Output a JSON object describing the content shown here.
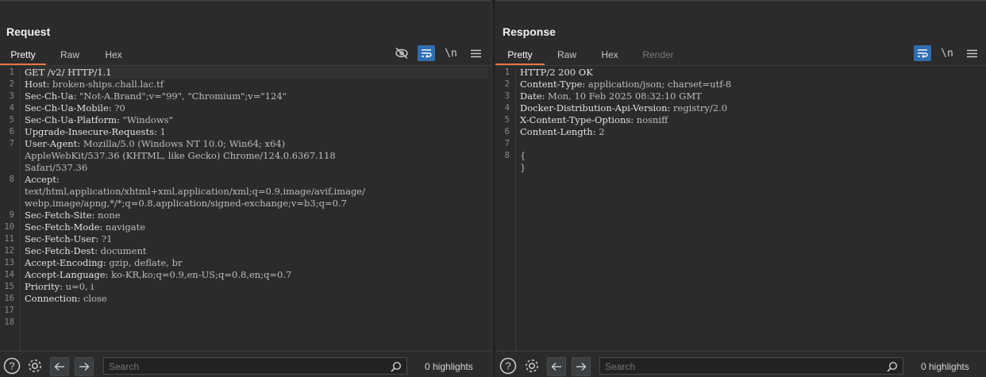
{
  "layout_buttons": [
    "side-by-side",
    "stacked",
    "single"
  ],
  "request": {
    "title": "Request",
    "tabs": [
      "Pretty",
      "Raw",
      "Hex"
    ],
    "active_tab": "Pretty",
    "newline_label": "\\n",
    "lines": [
      {
        "n": "1",
        "k": "GET /v2/ HTTP/1.1",
        "v": ""
      },
      {
        "n": "2",
        "k": "Host:",
        "v": " broken-ships.chall.lac.tf"
      },
      {
        "n": "3",
        "k": "Sec-Ch-Ua:",
        "v": " \"Not-A.Brand\";v=\"99\", \"Chromium\";v=\"124\""
      },
      {
        "n": "4",
        "k": "Sec-Ch-Ua-Mobile:",
        "v": " ?0"
      },
      {
        "n": "5",
        "k": "Sec-Ch-Ua-Platform:",
        "v": " \"Windows\""
      },
      {
        "n": "6",
        "k": "Upgrade-Insecure-Requests:",
        "v": " 1"
      },
      {
        "n": "7",
        "k": "User-Agent:",
        "v": " Mozilla/5.0 (Windows NT 10.0; Win64; x64)\nAppleWebKit/537.36 (KHTML, like Gecko) Chrome/124.0.6367.118\nSafari/537.36"
      },
      {
        "n": "8",
        "k": "Accept:",
        "v": "\ntext/html,application/xhtml+xml,application/xml;q=0.9,image/avif,image/\nwebp,image/apng,*/*;q=0.8,application/signed-exchange;v=b3;q=0.7"
      },
      {
        "n": "9",
        "k": "Sec-Fetch-Site:",
        "v": " none"
      },
      {
        "n": "10",
        "k": "Sec-Fetch-Mode:",
        "v": " navigate"
      },
      {
        "n": "11",
        "k": "Sec-Fetch-User:",
        "v": " ?1"
      },
      {
        "n": "12",
        "k": "Sec-Fetch-Dest:",
        "v": " document"
      },
      {
        "n": "13",
        "k": "Accept-Encoding:",
        "v": " gzip, deflate, br"
      },
      {
        "n": "14",
        "k": "Accept-Language:",
        "v": " ko-KR,ko;q=0.9,en-US;q=0.8,en;q=0.7"
      },
      {
        "n": "15",
        "k": "Priority:",
        "v": " u=0, i"
      },
      {
        "n": "16",
        "k": "Connection:",
        "v": " close"
      },
      {
        "n": "17",
        "k": "",
        "v": ""
      },
      {
        "n": "18",
        "k": "",
        "v": ""
      }
    ],
    "search_placeholder": "Search",
    "highlights": "0 highlights"
  },
  "response": {
    "title": "Response",
    "tabs": [
      "Pretty",
      "Raw",
      "Hex",
      "Render"
    ],
    "active_tab": "Pretty",
    "newline_label": "\\n",
    "lines": [
      {
        "n": "1",
        "k": "HTTP/2 200 OK",
        "v": ""
      },
      {
        "n": "2",
        "k": "Content-Type:",
        "v": " application/json; charset=utf-8"
      },
      {
        "n": "3",
        "k": "Date:",
        "v": " Mon, 10 Feb 2025 08:32:10 GMT"
      },
      {
        "n": "4",
        "k": "Docker-Distribution-Api-Version:",
        "v": " registry/2.0"
      },
      {
        "n": "5",
        "k": "X-Content-Type-Options:",
        "v": " nosniff"
      },
      {
        "n": "6",
        "k": "Content-Length:",
        "v": " 2"
      },
      {
        "n": "7",
        "k": "",
        "v": ""
      },
      {
        "n": "8",
        "k": "",
        "v": "{\n}"
      }
    ],
    "search_placeholder": "Search",
    "highlights": "0 highlights"
  },
  "colors": {
    "accent": "#e5793a",
    "toggle_on": "#2f6db0",
    "background": "#2b2b2b"
  }
}
